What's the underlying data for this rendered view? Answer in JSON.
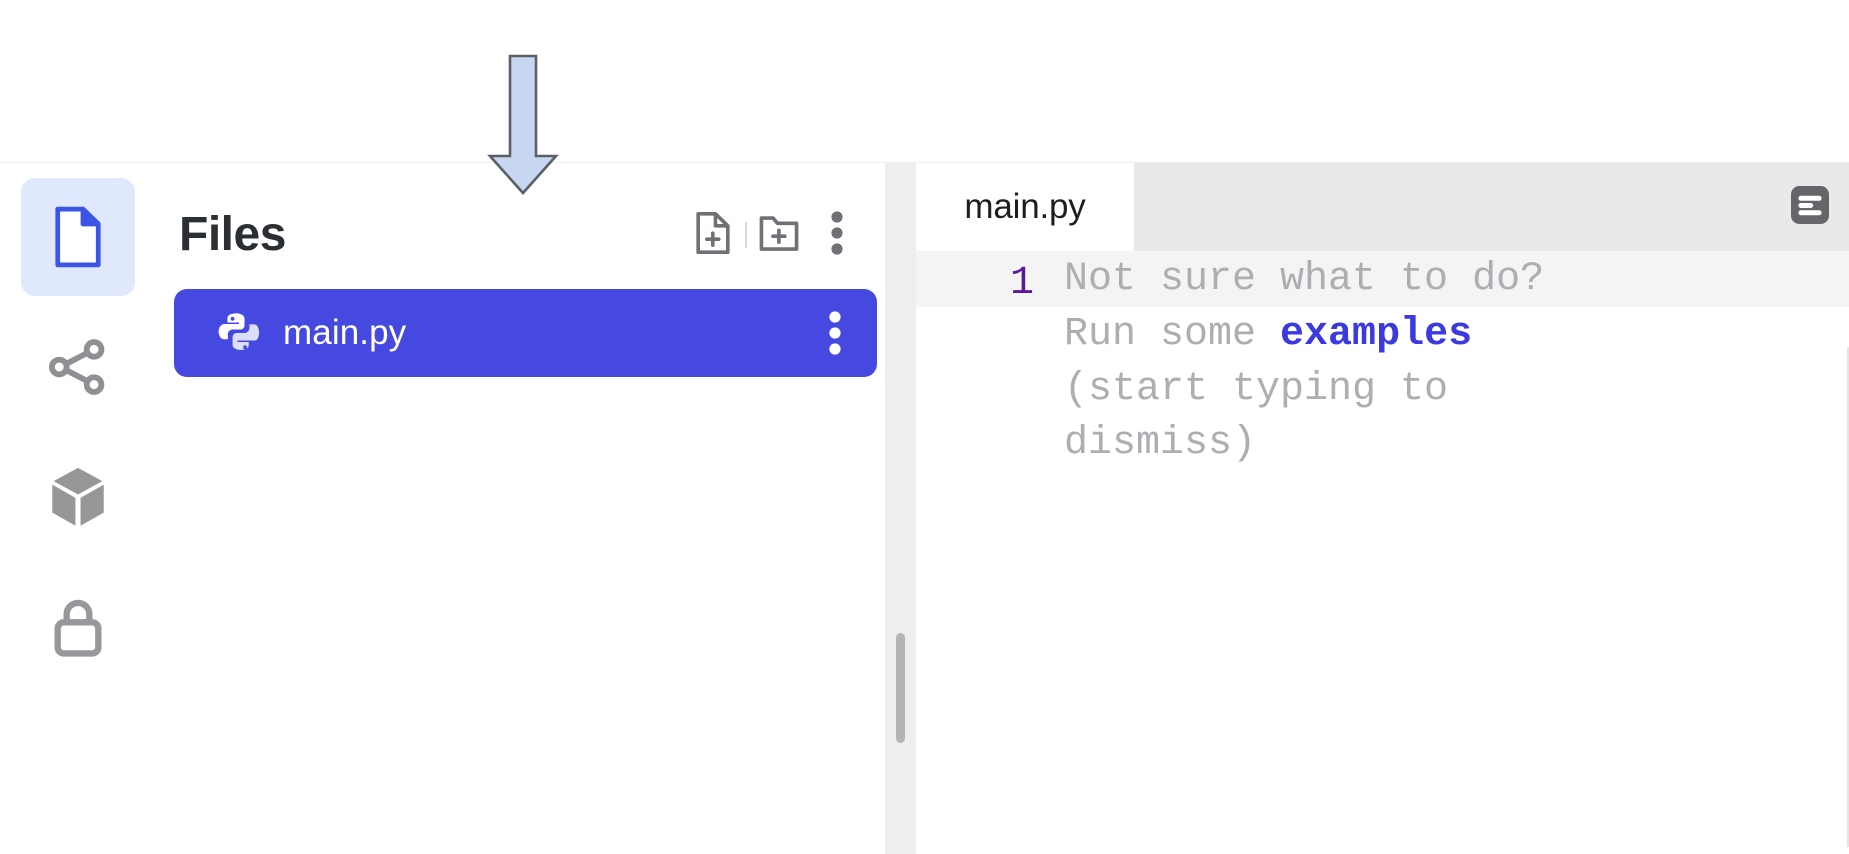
{
  "colors": {
    "accent_blue": "#4649e0",
    "accent_blue_text": "#3b39e0",
    "rail_active_bg": "#dfe8fd",
    "line_number_purple": "#5a189a",
    "placeholder_gray": "#adadb2",
    "tabbar_gray": "#e9e9ea",
    "annotation_fill": "#c7d6f1",
    "annotation_stroke": "#5b6068"
  },
  "rail": {
    "items": [
      {
        "id": "files",
        "icon": "file-document-icon",
        "label": "Files",
        "active": true
      },
      {
        "id": "git",
        "icon": "share-nodes-icon",
        "label": "Git",
        "active": false
      },
      {
        "id": "packages",
        "icon": "package-cube-icon",
        "label": "Packages",
        "active": false
      },
      {
        "id": "secrets",
        "icon": "lock-icon",
        "label": "Secrets",
        "active": false
      }
    ]
  },
  "files_panel": {
    "title": "Files",
    "actions": [
      {
        "id": "new-file",
        "icon": "new-file-icon",
        "label": "Add file"
      },
      {
        "id": "new-folder",
        "icon": "new-folder-icon",
        "label": "Add folder"
      },
      {
        "id": "more",
        "icon": "more-vertical-icon",
        "label": "More options"
      }
    ],
    "items": [
      {
        "name": "main.py",
        "icon": "python-icon",
        "selected": true,
        "row_menu_icon": "more-vertical-icon"
      }
    ]
  },
  "editor": {
    "tabs": [
      {
        "label": "main.py",
        "active": true
      }
    ],
    "pane_menu_icon": "pane-options-icon",
    "line_numbers": [
      "1"
    ],
    "placeholder": {
      "before": "Not sure what to do?\nRun some ",
      "link": "examples",
      "after": "\n(start typing to\ndismiss)"
    }
  },
  "annotation": {
    "type": "down-arrow",
    "points_to": "new-file-icon"
  }
}
